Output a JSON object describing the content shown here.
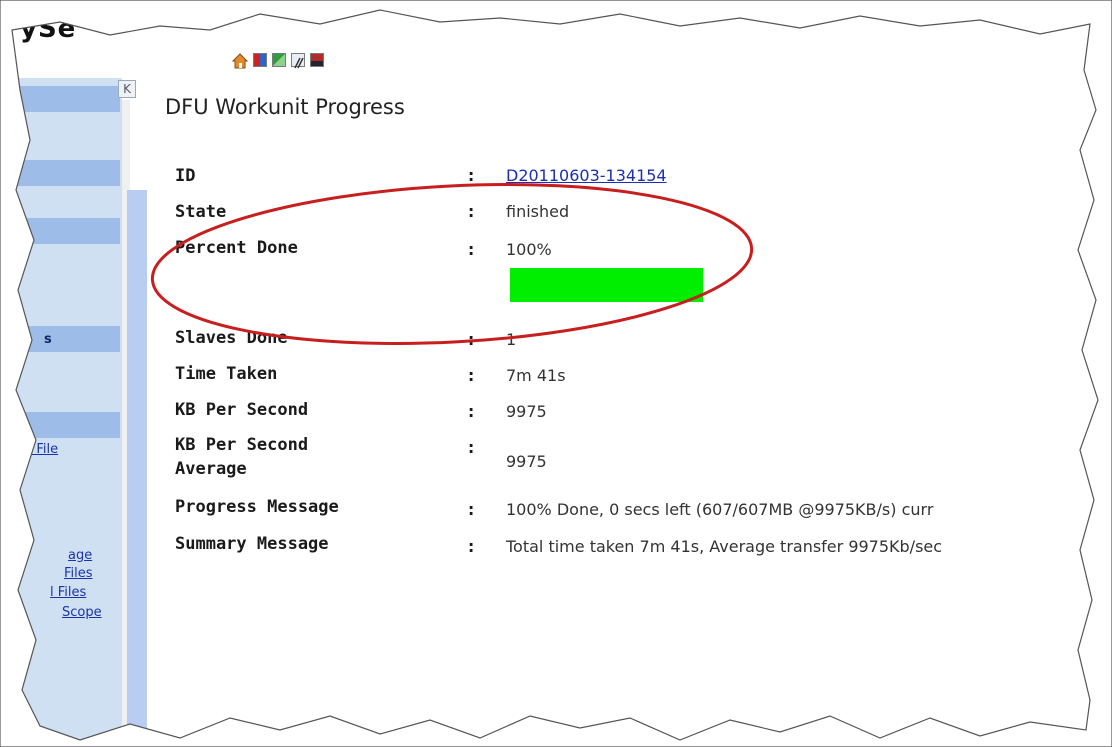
{
  "header": {
    "title_fragment": "ySe"
  },
  "toolbar": {
    "icons": [
      "home-icon",
      "color-grid-icon",
      "refresh-icon",
      "tools-icon",
      "monitor-icon"
    ],
    "colors": {
      "home": "#e08a2c",
      "grid": "#2e63c8",
      "refresh": "#2e9e3a",
      "tools": "#5466a8",
      "monitor": "#b22a2a"
    }
  },
  "sidebar": {
    "collapse_glyph": "K",
    "bold_item": "s",
    "links": [
      "ad File",
      "age",
      "Files",
      "l Files",
      "Scope"
    ]
  },
  "main": {
    "title": "DFU Workunit Progress",
    "rows": [
      {
        "label": "ID",
        "value": "D20110603-134154"
      },
      {
        "label": "State",
        "value": "finished"
      },
      {
        "label": "Percent Done",
        "value": "100%"
      },
      {
        "label": "Slaves Done",
        "value": "1"
      },
      {
        "label": "Time Taken",
        "value": "7m 41s"
      },
      {
        "label": "KB Per Second",
        "value": "9975"
      },
      {
        "label": "KB Per Second Average",
        "value": "9975"
      },
      {
        "label": "Progress Message",
        "value": "100% Done, 0 secs left (607/607MB @9975KB/s) curr"
      },
      {
        "label": "Summary Message",
        "value": "Total time taken 7m 41s, Average transfer 9975Kb/sec"
      }
    ],
    "separator": ":",
    "progress": {
      "percent": 100,
      "fill_color": "#00ee00"
    },
    "highlight_color": "#c81e1e"
  }
}
